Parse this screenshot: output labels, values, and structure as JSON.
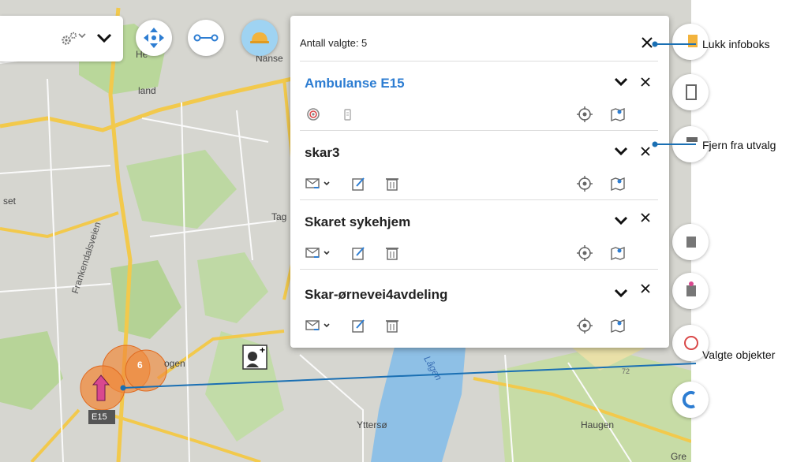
{
  "map": {
    "labels": {
      "place_land": "land",
      "place_set": "set",
      "place_tag": "Tag",
      "place_nanse": "Nanse",
      "place_he": "He",
      "place_ogen": "ogen",
      "place_yttersø": "Yttersø",
      "place_haugen": "Haugen",
      "river_lagen": "Lågen",
      "road_frankendalsveien": "Frankendalsveien",
      "road_72": "72",
      "shield_e15": "E15",
      "place_gre": "Gre"
    },
    "selection_count_bubble": "6"
  },
  "toolbar": {
    "gears_icon": "gears-icon",
    "collapse_icon": "chevron-down-icon",
    "pan_icon": "move-arrows-icon",
    "route_icon": "route-icon",
    "active_icon": "helmet-icon"
  },
  "panel": {
    "count_label": "Antall valgte: 5",
    "objects": [
      {
        "title": "Ambulanse E15",
        "is_link": true
      },
      {
        "title": "skar3",
        "is_link": false
      },
      {
        "title": "Skaret sykehjem",
        "is_link": false
      },
      {
        "title": "Skar-ørnevei4avdeling",
        "is_link": false
      }
    ]
  },
  "callouts": {
    "close_infobox": "Lukk infoboks",
    "remove_from_selection": "Fjern fra utvalg",
    "selected_objects": "Valgte objekter"
  },
  "colors": {
    "accent_blue": "#2d7dd2",
    "callout_line": "#1a6fb3",
    "selection_orange": "#f08a3c",
    "vehicle_marker": "#d9488f"
  }
}
